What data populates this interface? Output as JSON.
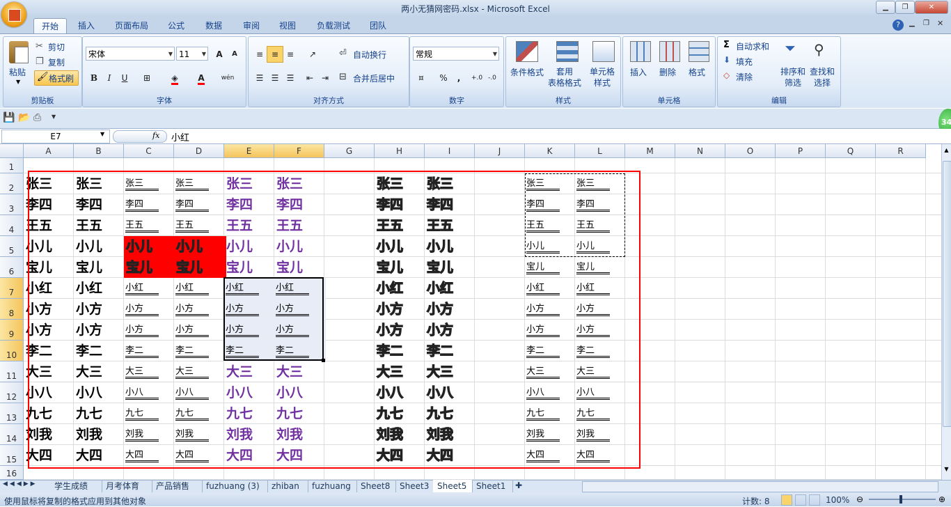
{
  "window": {
    "title": "两小无猜网密码.xlsx - Microsoft Excel"
  },
  "tabs": [
    "开始",
    "插入",
    "页面布局",
    "公式",
    "数据",
    "审阅",
    "视图",
    "负载测试",
    "团队"
  ],
  "ribbon": {
    "clipboard": {
      "label": "剪贴板",
      "paste": "粘贴",
      "cut": "剪切",
      "copy": "复制",
      "format_painter": "格式刷"
    },
    "font": {
      "label": "字体",
      "name": "宋体",
      "size": "11",
      "bold": "B",
      "italic": "I",
      "underline": "U",
      "grow": "A",
      "shrink": "A",
      "font_color": "A",
      "phonetic": "wén"
    },
    "alignment": {
      "label": "对齐方式",
      "wrap": "自动换行",
      "merge": "合并后居中"
    },
    "number": {
      "label": "数字",
      "format": "常规",
      "percent": "%",
      "comma": ","
    },
    "styles": {
      "label": "样式",
      "conditional": "条件格式",
      "table": "套用\n表格格式",
      "cell_styles": "单元格\n样式"
    },
    "cells": {
      "label": "单元格",
      "insert": "插入",
      "delete": "删除",
      "format": "格式"
    },
    "editing": {
      "label": "编辑",
      "autosum": "自动求和",
      "fill": "填充",
      "clear": "清除",
      "sort": "排序和\n筛选",
      "find": "查找和\n选择"
    }
  },
  "formula": {
    "cell_ref": "E7",
    "fx": "fx",
    "value": "小红"
  },
  "columns": [
    "A",
    "B",
    "C",
    "D",
    "E",
    "F",
    "G",
    "H",
    "I",
    "J",
    "K",
    "L",
    "M",
    "N",
    "O",
    "P",
    "Q",
    "R"
  ],
  "rows": [
    "1",
    "2",
    "3",
    "4",
    "5",
    "6",
    "7",
    "8",
    "9",
    "10",
    "11",
    "12",
    "13",
    "14",
    "15",
    "16"
  ],
  "names": [
    "张三",
    "李四",
    "王五",
    "小儿",
    "宝儿",
    "小红",
    "小方",
    "小方",
    "李二",
    "大三",
    "小八",
    "九七",
    "刘我",
    "大四"
  ],
  "sheets": [
    "学生成绩",
    "月考体育",
    "产品销售",
    "fuzhuang (3)",
    "zhiban",
    "fuzhuang",
    "Sheet8",
    "Sheet3",
    "Sheet5",
    "Sheet1"
  ],
  "active_sheet": "Sheet5",
  "status": {
    "message": "使用鼠标将复制的格式应用到其他对象",
    "count": "计数: 8",
    "zoom": "100%"
  },
  "badge": "34",
  "colors": {
    "accent": "#15428b",
    "red_fill": "#ff0000",
    "purple_text": "#7030a0",
    "highlight_box": "#ff0000"
  }
}
